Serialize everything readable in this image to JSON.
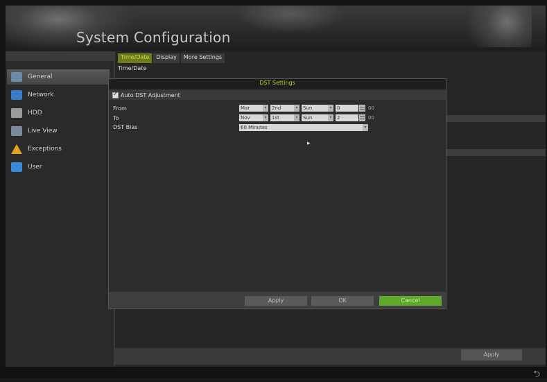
{
  "window": {
    "title": "System Configuration"
  },
  "sidebar": {
    "items": [
      {
        "label": "General",
        "icon": "gear-icon",
        "color": "#6a8aa8",
        "active": true
      },
      {
        "label": "Network",
        "icon": "network-icon",
        "color": "#3a7cc8"
      },
      {
        "label": "HDD",
        "icon": "hdd-icon",
        "color": "#9a9a9a"
      },
      {
        "label": "Live View",
        "icon": "monitor-icon",
        "color": "#7a8a9a"
      },
      {
        "label": "Exceptions",
        "icon": "warning-icon",
        "color": "#e8a020"
      },
      {
        "label": "User",
        "icon": "user-icon",
        "color": "#3a8ad8"
      }
    ]
  },
  "tabs": [
    {
      "label": "Time/Date",
      "active": true
    },
    {
      "label": "Display"
    },
    {
      "label": "More Settings"
    }
  ],
  "section": {
    "title": "Time/Date"
  },
  "dialog": {
    "title": "DST Settings",
    "auto_dst_label": "Auto DST Adjustment",
    "auto_dst_checked": true,
    "from": {
      "label": "From",
      "month": "Mar",
      "week": "2nd",
      "day": "Sun",
      "hour": "0",
      "suffix": "00"
    },
    "to": {
      "label": "To",
      "month": "Nov",
      "week": "1st",
      "day": "Sun",
      "hour": "2",
      "suffix": "00"
    },
    "bias": {
      "label": "DST Bias",
      "value": "60 Minutes"
    },
    "buttons": {
      "apply": "Apply",
      "ok": "OK",
      "cancel": "Cancel"
    }
  },
  "footer": {
    "apply_label": "Apply",
    "enter_icon": "enter-icon"
  },
  "colors": {
    "accent": "#c9dd40",
    "cancel": "#5fa82a"
  }
}
